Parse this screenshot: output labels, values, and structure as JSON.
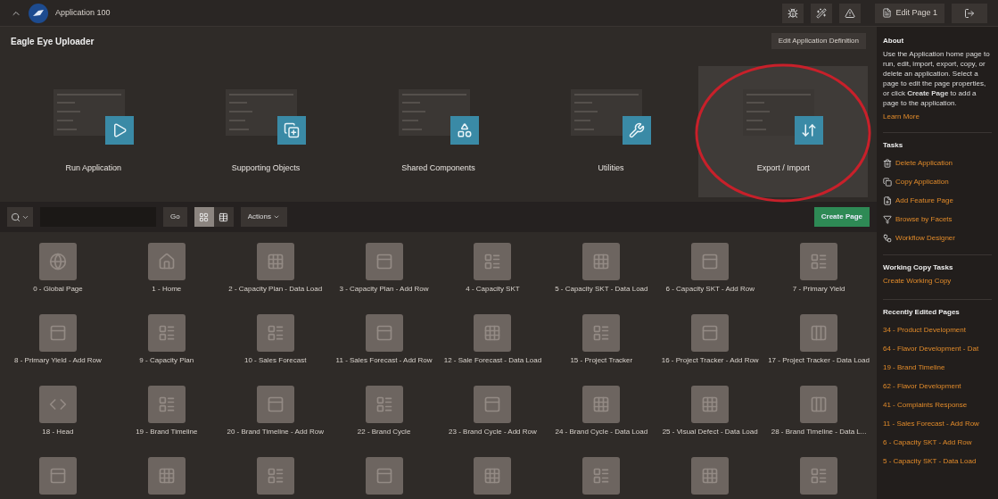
{
  "top_bar": {
    "breadcrumb": "Application 100",
    "edit_page": "Edit Page 1"
  },
  "header": {
    "title": "Eagle Eye Uploader",
    "edit_definition": "Edit Application Definition"
  },
  "tiles": [
    {
      "label": "Run Application",
      "kind": "run",
      "selected": false,
      "circled": false
    },
    {
      "label": "Supporting Objects",
      "kind": "supporting",
      "selected": false,
      "circled": false
    },
    {
      "label": "Shared Components",
      "kind": "shared",
      "selected": false,
      "circled": false
    },
    {
      "label": "Utilities",
      "kind": "utilities",
      "selected": false,
      "circled": false
    },
    {
      "label": "Export / Import",
      "kind": "export",
      "selected": true,
      "circled": true
    }
  ],
  "toolbar": {
    "go": "Go",
    "views": [
      {
        "kind": "icons",
        "selected": true
      },
      {
        "kind": "report",
        "selected": false
      }
    ],
    "actions": "Actions",
    "create_page": "Create Page"
  },
  "pages": [
    {
      "label": "0 - Global Page",
      "kind": "globe"
    },
    {
      "label": "1 - Home",
      "kind": "home"
    },
    {
      "label": "2 - Capacity Plan - Data Load",
      "kind": "grid"
    },
    {
      "label": "3 - Capacity Plan - Add Row",
      "kind": "form"
    },
    {
      "label": "4 - Capacity SKT",
      "kind": "report"
    },
    {
      "label": "5 - Capacity SKT - Data Load",
      "kind": "grid"
    },
    {
      "label": "6 - Capacity SKT - Add Row",
      "kind": "form"
    },
    {
      "label": "7 - Primary Yield",
      "kind": "report"
    },
    {
      "label": "8 - Primary Yield - Add Row",
      "kind": "form"
    },
    {
      "label": "9 - Capacity Plan",
      "kind": "report"
    },
    {
      "label": "10 - Sales Forecast",
      "kind": "report"
    },
    {
      "label": "11 - Sales Forecast - Add Row",
      "kind": "form"
    },
    {
      "label": "12 - Sale Forecast - Data Load",
      "kind": "grid"
    },
    {
      "label": "15 - Project Tracker",
      "kind": "report"
    },
    {
      "label": "16 - Project Tracker - Add Row",
      "kind": "form"
    },
    {
      "label": "17 - Project Tracker - Data Load",
      "kind": "columns"
    },
    {
      "label": "18 - Head",
      "kind": "code"
    },
    {
      "label": "19 - Brand Timeline",
      "kind": "report"
    },
    {
      "label": "20 - Brand Timeline - Add Row",
      "kind": "form"
    },
    {
      "label": "22 - Brand Cycle",
      "kind": "report"
    },
    {
      "label": "23 - Brand Cycle - Add Row",
      "kind": "form"
    },
    {
      "label": "24 - Brand Cycle - Data Load",
      "kind": "grid"
    },
    {
      "label": "25 - Visual Defect - Data Load",
      "kind": "grid"
    },
    {
      "label": "28 - Brand Timeline - Data L...",
      "kind": "columns"
    },
    {
      "kind": "form"
    },
    {
      "kind": "grid"
    },
    {
      "kind": "report"
    },
    {
      "kind": "form"
    },
    {
      "kind": "grid"
    },
    {
      "kind": "report"
    },
    {
      "kind": "grid"
    },
    {
      "kind": "report"
    }
  ],
  "sidebar": {
    "about": {
      "heading": "About",
      "text": "Use the Application home page to run, edit, import, export, copy, or delete an application. Select a page to edit the page properties, or click **Create Page** to add a page to the application.",
      "link": "Learn More"
    },
    "tasks": {
      "heading": "Tasks",
      "items": [
        {
          "label": "Delete Application",
          "kind": "trash"
        },
        {
          "label": "Copy Application",
          "kind": "copy"
        },
        {
          "label": "Add Feature Page",
          "kind": "add"
        },
        {
          "label": "Browse by Facets",
          "kind": "filter"
        },
        {
          "label": "Workflow Designer",
          "kind": "workflow"
        }
      ]
    },
    "working_copy": {
      "heading": "Working Copy Tasks",
      "items": [
        "Create Working Copy"
      ]
    },
    "recent": {
      "heading": "Recently Edited Pages",
      "items": [
        "34 - Product Development",
        "64 - Flavor Development - Dat",
        "19 - Brand Timeline",
        "62 - Flavor Development",
        "41 - Complaints Response",
        "11 - Sales Forecast - Add Row",
        "6 - Capacity SKT - Add Row",
        "5 - Capacity SKT - Data Load"
      ]
    }
  }
}
